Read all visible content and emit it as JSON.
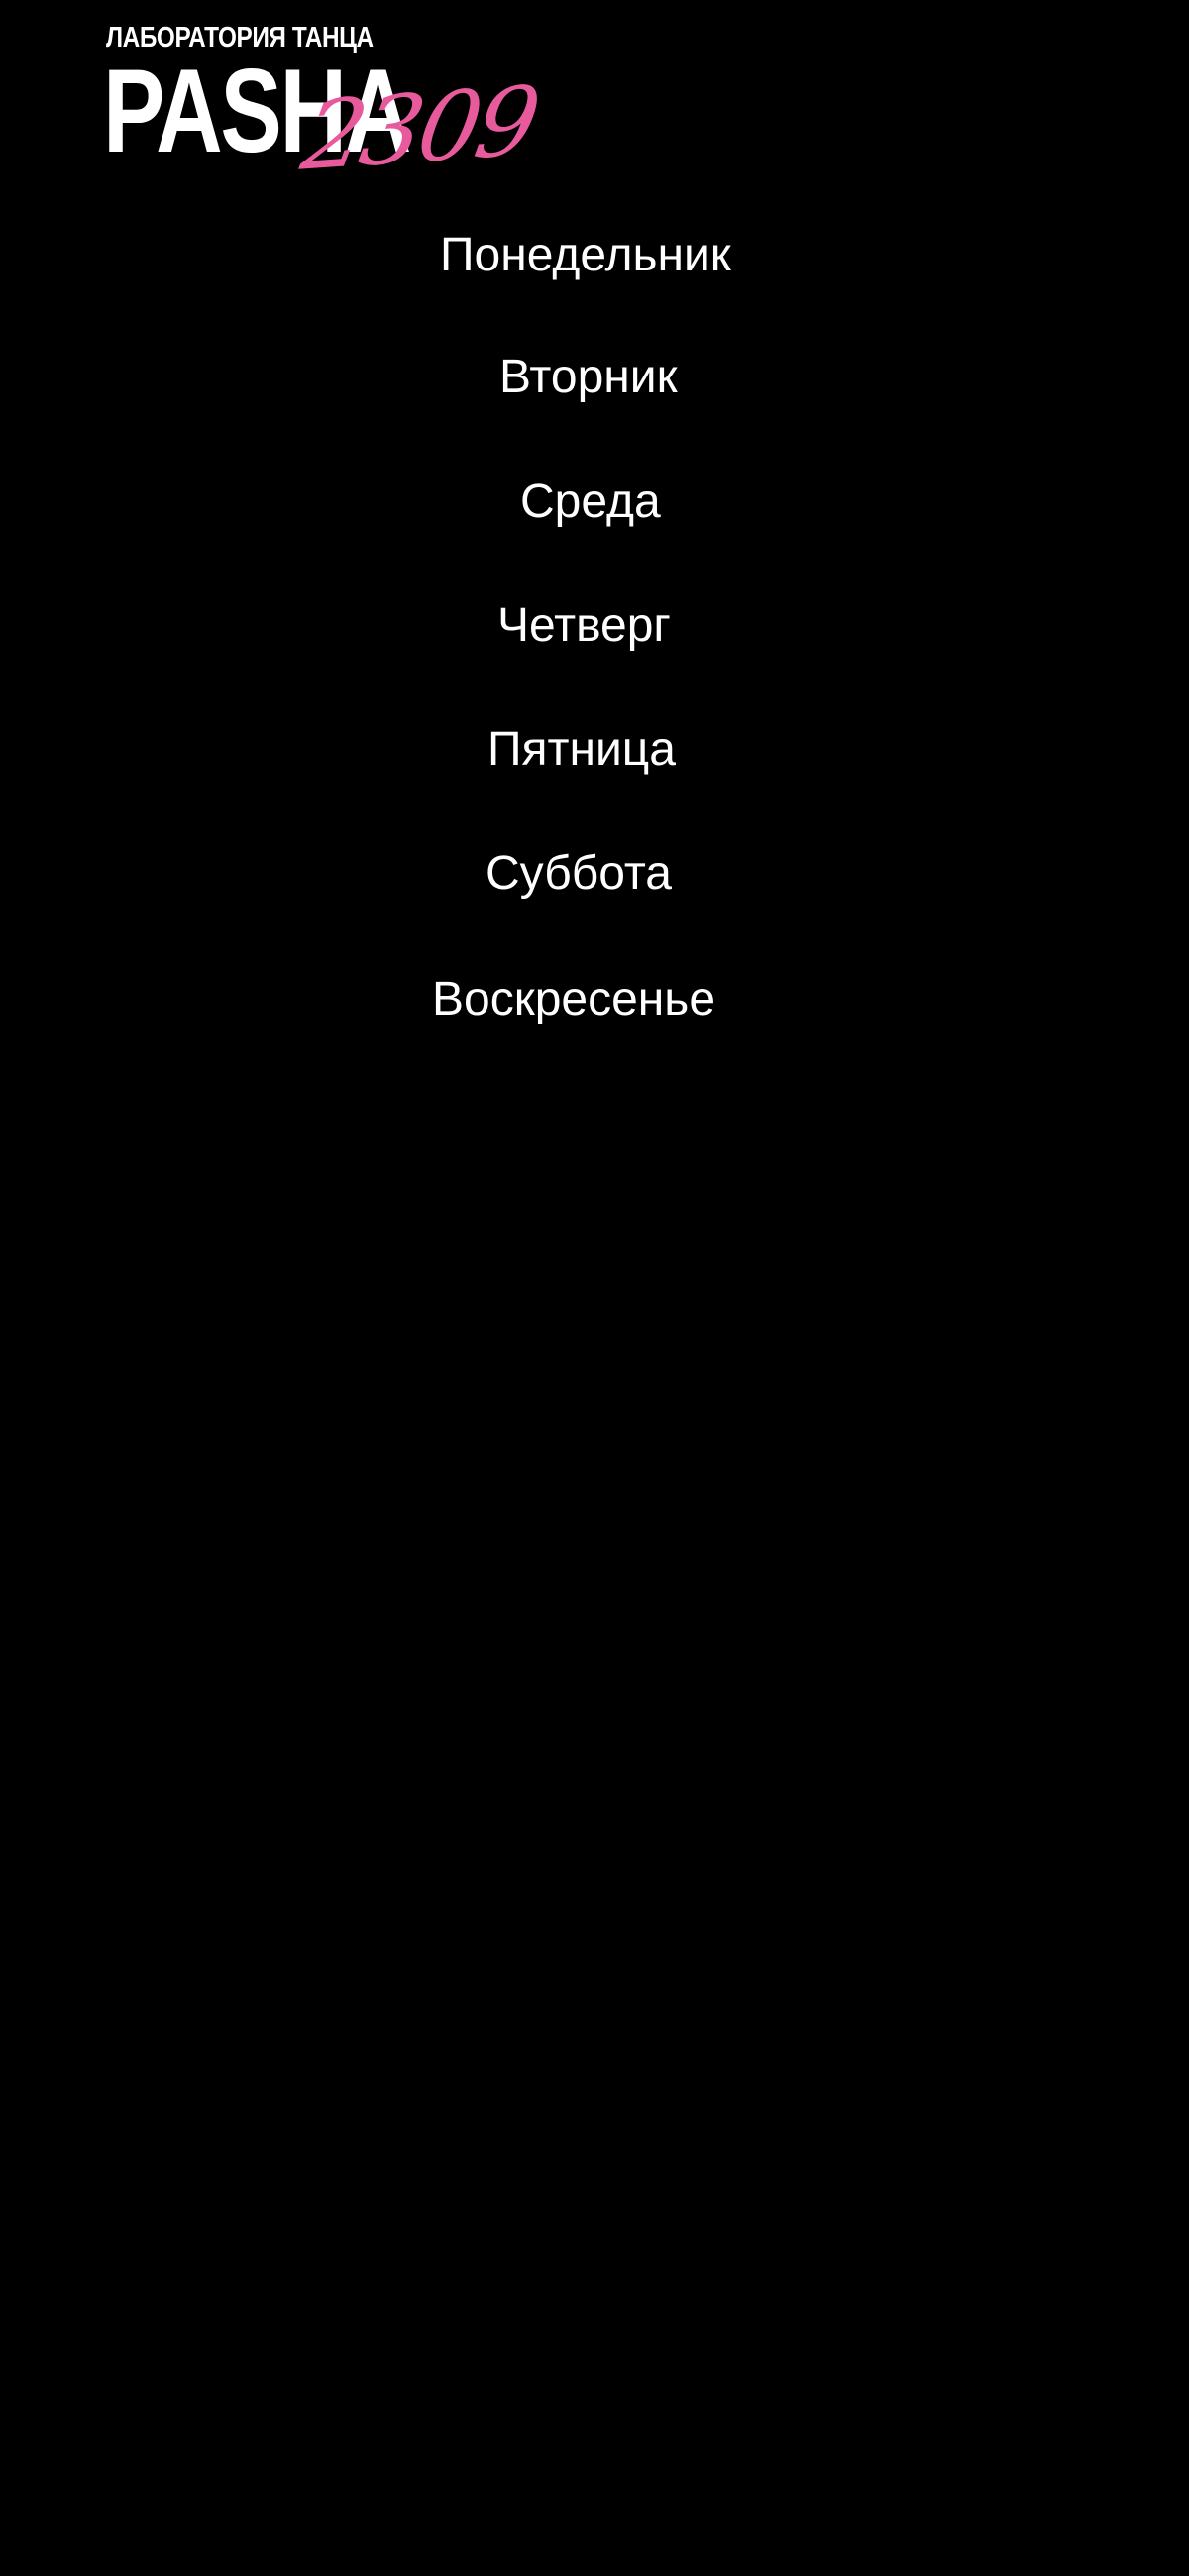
{
  "logo": {
    "subtitle": "ЛАБОРАТОРИЯ ТАНЦА",
    "name": "PASHA",
    "number": "2309",
    "accent_color": "#e75a9c"
  },
  "days": [
    {
      "label": "Понедельник"
    },
    {
      "label": "Вторник"
    },
    {
      "label": "Среда"
    },
    {
      "label": "Четверг"
    },
    {
      "label": "Пятница"
    },
    {
      "label": "Суббота"
    },
    {
      "label": "Воскресенье"
    }
  ]
}
